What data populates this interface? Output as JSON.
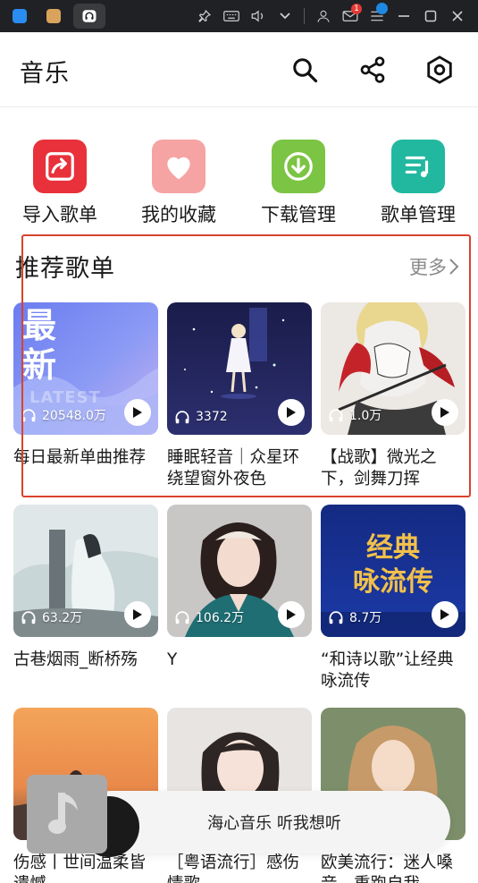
{
  "header": {
    "title": "音乐"
  },
  "os": {
    "mail_badge": "1"
  },
  "quick_actions": [
    {
      "label": "导入歌单",
      "icon": "import-playlist-icon",
      "color": "#e8313b"
    },
    {
      "label": "我的收藏",
      "icon": "heart-icon",
      "color": "#f6a3a3"
    },
    {
      "label": "下载管理",
      "icon": "download-icon",
      "color": "#7cc443"
    },
    {
      "label": "歌单管理",
      "icon": "playlist-manage-icon",
      "color": "#22b8a0"
    }
  ],
  "section": {
    "title": "推荐歌单",
    "more": "更多"
  },
  "cover_texts": {
    "latest_big": "最新",
    "latest_small": "LATEST"
  },
  "playlists": [
    {
      "title": "每日最新单曲推荐",
      "count": "20548.0万"
    },
    {
      "title": "睡眠轻音｜众星环绕望窗外夜色",
      "count": "3372"
    },
    {
      "title": "【战歌】微光之下，剑舞刀挥",
      "count": "1.0万"
    },
    {
      "title": "古巷烟雨_断桥殇",
      "count": "63.2万"
    },
    {
      "title": "Y",
      "count": "106.2万"
    },
    {
      "title": "“和诗以歌”让经典咏流传",
      "count": "8.7万"
    },
    {
      "title": "伤感丨世间温柔皆遗憾",
      "count": ""
    },
    {
      "title": "［粤语流行］感伤情歌",
      "count": ""
    },
    {
      "title": "欧美流行：迷人嗓音，重跑自我",
      "count": ""
    }
  ],
  "mini_player": {
    "text": "海心音乐 听我想听"
  },
  "colors": {
    "accent_red": "#d9432f"
  }
}
